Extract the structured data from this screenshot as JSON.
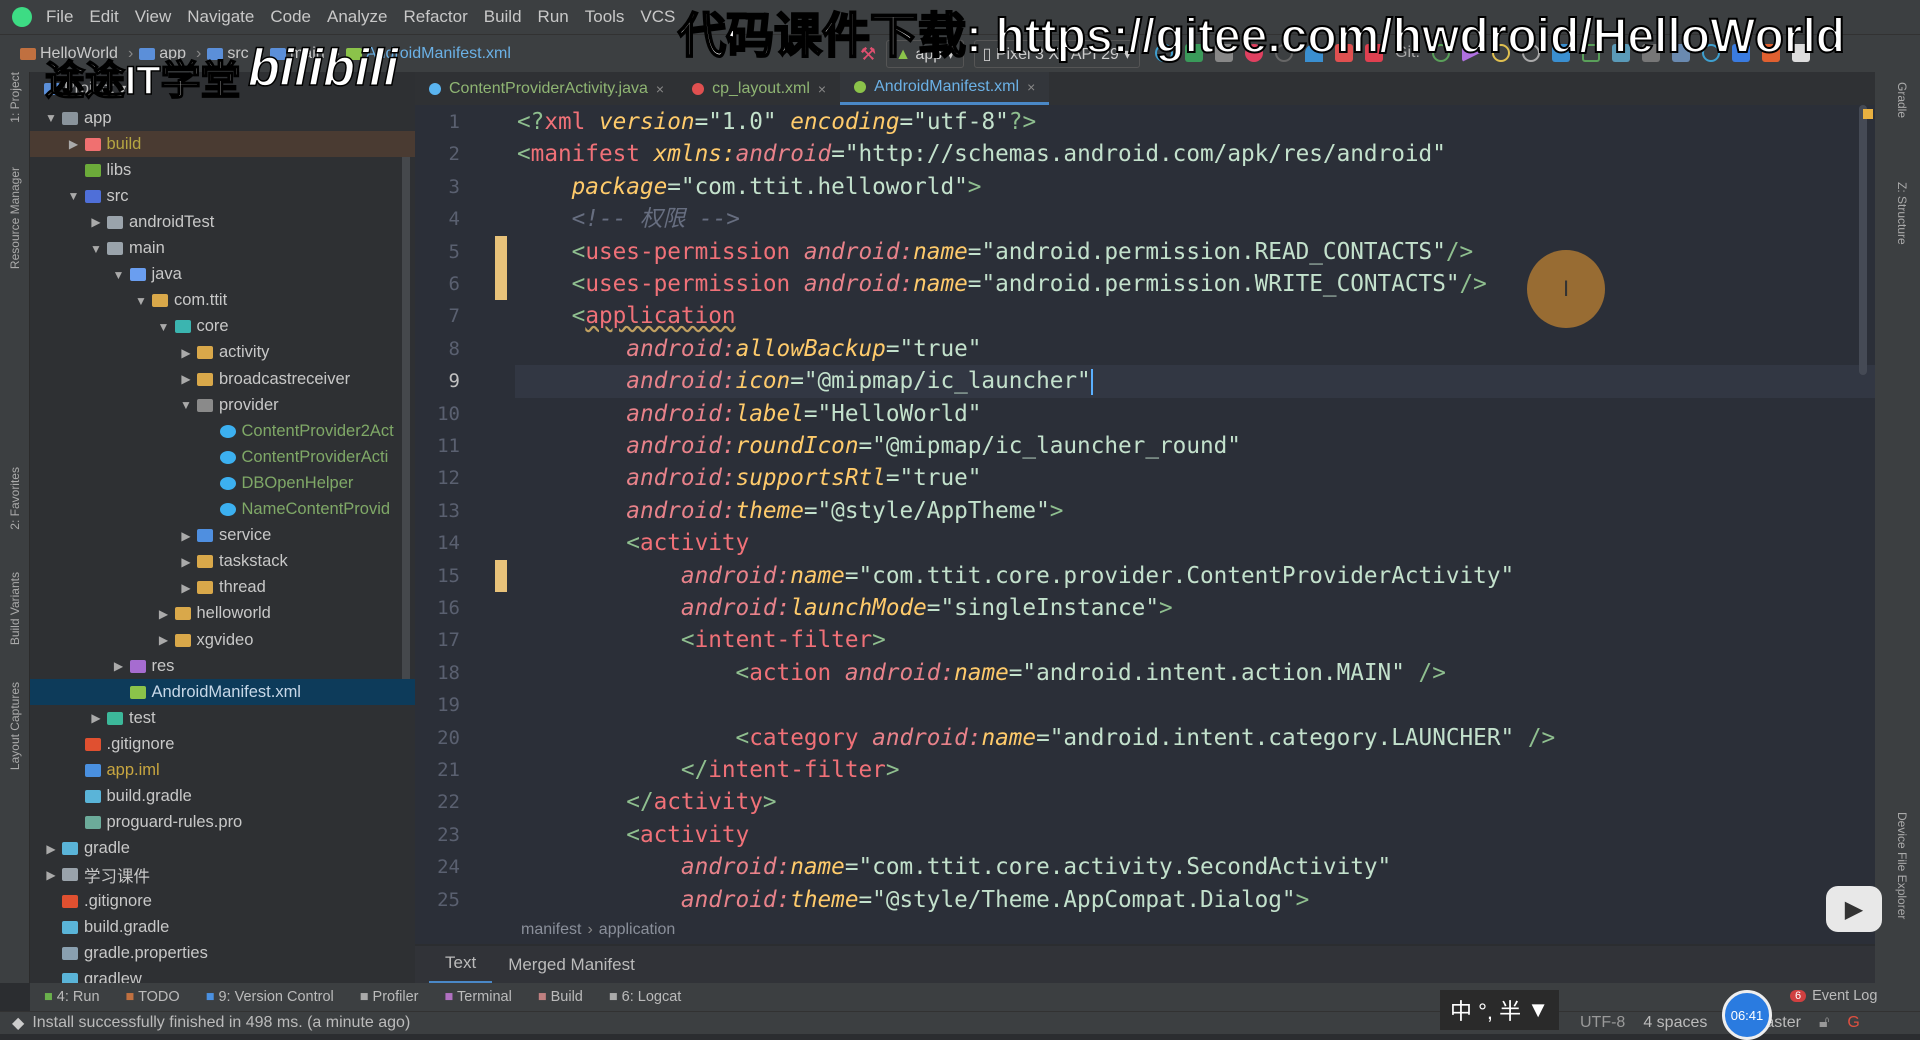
{
  "menu": [
    "File",
    "Edit",
    "View",
    "Navigate",
    "Code",
    "Analyze",
    "Refactor",
    "Build",
    "Run",
    "Tools",
    "VCS"
  ],
  "breadcrumb": [
    "HelloWorld",
    "app",
    "src",
    "main",
    "AndroidManifest.xml"
  ],
  "run_config": {
    "module": "app",
    "device": "Pixel 3 XL API 29",
    "git_label": "Git:"
  },
  "watermarks": {
    "channel": "途途IT学堂",
    "site_logo": "bilibili",
    "download": "代码课件下载: https://gitee.com/hwdroid/HelloWorld"
  },
  "project_panel": {
    "title": "Project"
  },
  "file_tabs": [
    {
      "label": "ContentProviderActivity.java",
      "color": "#8fb573",
      "icon": "#5ab4f0",
      "active": false
    },
    {
      "label": "cp_layout.xml",
      "color": "#8fb573",
      "icon": "#e05050",
      "active": false
    },
    {
      "label": "AndroidManifest.xml",
      "color": "#6bb1e6",
      "icon": "#8bc34a",
      "active": true
    }
  ],
  "tree": [
    {
      "level": 0,
      "arrow": "down",
      "icon": "#8a949c",
      "label": "app"
    },
    {
      "level": 1,
      "arrow": "right",
      "icon": "#f07070",
      "label": "build",
      "color": "#b5a642",
      "state": "highlight"
    },
    {
      "level": 1,
      "arrow": "",
      "icon": "#6cab3a",
      "label": "libs"
    },
    {
      "level": 1,
      "arrow": "down",
      "icon": "#4f6fd8",
      "label": "src"
    },
    {
      "level": 2,
      "arrow": "right",
      "icon": "#9aa3ab",
      "label": "androidTest"
    },
    {
      "level": 2,
      "arrow": "down",
      "icon": "#9aa3ab",
      "label": "main"
    },
    {
      "level": 3,
      "arrow": "down",
      "icon": "#6a9ef0",
      "label": "java"
    },
    {
      "level": 4,
      "arrow": "right-down",
      "icon": "#d9a84a",
      "label": "com.ttit"
    },
    {
      "level": 5,
      "arrow": "down",
      "icon": "#3bb5b0",
      "label": "core"
    },
    {
      "level": 6,
      "arrow": "right",
      "icon": "#d9a84a",
      "label": "activity"
    },
    {
      "level": 6,
      "arrow": "right",
      "icon": "#d9a84a",
      "label": "broadcastreceiver"
    },
    {
      "level": 6,
      "arrow": "down",
      "icon": "#8a8a8a",
      "label": "provider"
    },
    {
      "level": 7,
      "arrow": "",
      "icon": "#3cb0f0",
      "label": "ContentProvider2Act",
      "color": "#7fa867"
    },
    {
      "level": 7,
      "arrow": "",
      "icon": "#3cb0f0",
      "label": "ContentProviderActi",
      "color": "#7fa867"
    },
    {
      "level": 7,
      "arrow": "",
      "icon": "#3cb0f0",
      "label": "DBOpenHelper",
      "color": "#7fa867"
    },
    {
      "level": 7,
      "arrow": "",
      "icon": "#3cb0f0",
      "label": "NameContentProvid",
      "color": "#7fa867"
    },
    {
      "level": 6,
      "arrow": "right",
      "icon": "#4f8fe0",
      "label": "service"
    },
    {
      "level": 6,
      "arrow": "right",
      "icon": "#d9a84a",
      "label": "taskstack"
    },
    {
      "level": 6,
      "arrow": "right",
      "icon": "#d9a84a",
      "label": "thread"
    },
    {
      "level": 5,
      "arrow": "right",
      "icon": "#d9a84a",
      "label": "helloworld"
    },
    {
      "level": 5,
      "arrow": "right",
      "icon": "#d9a84a",
      "label": "xgvideo"
    },
    {
      "level": 3,
      "arrow": "right",
      "icon": "#a66cd0",
      "label": "res"
    },
    {
      "level": 3,
      "arrow": "",
      "icon": "#8bc34a",
      "label": "AndroidManifest.xml",
      "color": "#c8d8e8",
      "state": "selected"
    },
    {
      "level": 2,
      "arrow": "right",
      "icon": "#3cb89a",
      "label": "test"
    },
    {
      "level": 1,
      "arrow": "",
      "icon": "#e05030",
      "label": ".gitignore"
    },
    {
      "level": 1,
      "arrow": "",
      "icon": "#4a90e0",
      "label": "app.iml",
      "color": "#c8a640"
    },
    {
      "level": 1,
      "arrow": "",
      "icon": "#5ab4d8",
      "label": "build.gradle"
    },
    {
      "level": 1,
      "arrow": "",
      "icon": "#6cab9a",
      "label": "proguard-rules.pro"
    },
    {
      "level": 0,
      "arrow": "right",
      "icon": "#5ab4d8",
      "label": "gradle"
    },
    {
      "level": 0,
      "arrow": "right",
      "icon": "#9aa3ab",
      "label": "学习课件"
    },
    {
      "level": 0,
      "arrow": "",
      "icon": "#e05030",
      "label": ".gitignore"
    },
    {
      "level": 0,
      "arrow": "",
      "icon": "#5ab4d8",
      "label": "build.gradle"
    },
    {
      "level": 0,
      "arrow": "",
      "icon": "#8aa0b0",
      "label": "gradle.properties"
    },
    {
      "level": 0,
      "arrow": "",
      "icon": "#5ab4d8",
      "label": "gradlew"
    }
  ],
  "code": {
    "current_line": 9,
    "changed_lines": [
      5,
      6,
      15
    ],
    "lines": [
      [
        [
          "b",
          "<?"
        ],
        [
          "t",
          "xml"
        ],
        [
          "a",
          " version"
        ],
        [
          "v",
          "=\"1.0\" "
        ],
        [
          "a",
          "encoding"
        ],
        [
          "v",
          "=\"utf-8\""
        ],
        [
          "b",
          "?>"
        ]
      ],
      [
        [
          "b",
          "<"
        ],
        [
          "t",
          "manifest "
        ],
        [
          "a",
          "xmlns:"
        ],
        [
          "ns",
          "android"
        ],
        [
          "v",
          "=\"http://schemas.android.com/apk/res/android\""
        ]
      ],
      [
        [
          "v",
          "    "
        ],
        [
          "a",
          "package"
        ],
        [
          "v",
          "=\"com.ttit.helloworld\""
        ],
        [
          "b",
          ">"
        ]
      ],
      [
        [
          "c",
          "    <!-- 权限 -->"
        ]
      ],
      [
        [
          "v",
          "    "
        ],
        [
          "b",
          "<"
        ],
        [
          "t",
          "uses-permission "
        ],
        [
          "ns",
          "android:"
        ],
        [
          "a",
          "name"
        ],
        [
          "v",
          "=\"android.permission.READ_CONTACTS\""
        ],
        [
          "b",
          "/>"
        ]
      ],
      [
        [
          "v",
          "    "
        ],
        [
          "b",
          "<"
        ],
        [
          "t",
          "uses-permission "
        ],
        [
          "ns",
          "android:"
        ],
        [
          "a",
          "name"
        ],
        [
          "v",
          "=\"android.permission.WRITE_CONTACTS\""
        ],
        [
          "b",
          "/>"
        ]
      ],
      [
        [
          "v",
          "    "
        ],
        [
          "b",
          "<"
        ],
        [
          "tu",
          "application"
        ]
      ],
      [
        [
          "v",
          "        "
        ],
        [
          "ns",
          "android:"
        ],
        [
          "a",
          "allowBackup"
        ],
        [
          "v",
          "=\"true\""
        ]
      ],
      [
        [
          "v",
          "        "
        ],
        [
          "ns",
          "android:"
        ],
        [
          "a",
          "icon"
        ],
        [
          "v",
          "=\"@mipmap/ic_launcher\""
        ],
        [
          "caret",
          ""
        ]
      ],
      [
        [
          "v",
          "        "
        ],
        [
          "ns",
          "android:"
        ],
        [
          "a",
          "label"
        ],
        [
          "v",
          "=\"HelloWorld\""
        ]
      ],
      [
        [
          "v",
          "        "
        ],
        [
          "ns",
          "android:"
        ],
        [
          "a",
          "roundIcon"
        ],
        [
          "v",
          "=\"@mipmap/ic_launcher_round\""
        ]
      ],
      [
        [
          "v",
          "        "
        ],
        [
          "ns",
          "android:"
        ],
        [
          "a",
          "supportsRtl"
        ],
        [
          "v",
          "=\"true\""
        ]
      ],
      [
        [
          "v",
          "        "
        ],
        [
          "ns",
          "android:"
        ],
        [
          "a",
          "theme"
        ],
        [
          "v",
          "=\"@style/AppTheme\""
        ],
        [
          "b",
          ">"
        ]
      ],
      [
        [
          "v",
          "        "
        ],
        [
          "b",
          "<"
        ],
        [
          "t",
          "activity"
        ]
      ],
      [
        [
          "v",
          "            "
        ],
        [
          "ns",
          "android:"
        ],
        [
          "a",
          "name"
        ],
        [
          "v",
          "=\"com.ttit.core.provider.ContentProviderActivity\""
        ]
      ],
      [
        [
          "v",
          "            "
        ],
        [
          "ns",
          "android:"
        ],
        [
          "a",
          "launchMode"
        ],
        [
          "v",
          "=\"singleInstance\""
        ],
        [
          "b",
          ">"
        ]
      ],
      [
        [
          "v",
          "            "
        ],
        [
          "b",
          "<"
        ],
        [
          "t",
          "intent-filter"
        ],
        [
          "b",
          ">"
        ]
      ],
      [
        [
          "v",
          "                "
        ],
        [
          "b",
          "<"
        ],
        [
          "t",
          "action "
        ],
        [
          "ns",
          "android:"
        ],
        [
          "a",
          "name"
        ],
        [
          "v",
          "=\"android.intent.action.MAIN\" "
        ],
        [
          "b",
          "/>"
        ]
      ],
      [],
      [
        [
          "v",
          "                "
        ],
        [
          "b",
          "<"
        ],
        [
          "t",
          "category "
        ],
        [
          "ns",
          "android:"
        ],
        [
          "a",
          "name"
        ],
        [
          "v",
          "=\"android.intent.category.LAUNCHER\" "
        ],
        [
          "b",
          "/>"
        ]
      ],
      [
        [
          "v",
          "            "
        ],
        [
          "b",
          "</"
        ],
        [
          "t",
          "intent-filter"
        ],
        [
          "b",
          ">"
        ]
      ],
      [
        [
          "v",
          "        "
        ],
        [
          "b",
          "</"
        ],
        [
          "t",
          "activity"
        ],
        [
          "b",
          ">"
        ]
      ],
      [
        [
          "v",
          "        "
        ],
        [
          "b",
          "<"
        ],
        [
          "t",
          "activity"
        ]
      ],
      [
        [
          "v",
          "            "
        ],
        [
          "ns",
          "android:"
        ],
        [
          "a",
          "name"
        ],
        [
          "v",
          "=\"com.ttit.core.activity.SecondActivity\""
        ]
      ],
      [
        [
          "v",
          "            "
        ],
        [
          "ns",
          "android:"
        ],
        [
          "a",
          "theme"
        ],
        [
          "v",
          "=\"@style/Theme.AppCompat.Dialog\""
        ],
        [
          "b",
          ">"
        ]
      ]
    ]
  },
  "editor_breadcrumb": [
    "manifest",
    "application"
  ],
  "editor_tabs": [
    {
      "label": "Text",
      "active": true
    },
    {
      "label": "Merged Manifest",
      "active": false
    }
  ],
  "tool_windows": [
    "4: Run",
    "TODO",
    "9: Version Control",
    "Profiler",
    "Terminal",
    "Build",
    "6: Logcat"
  ],
  "left_stripe": [
    "1: Project",
    "Resource Manager",
    "2: Favorites",
    "Build Variants",
    "Layout Captures"
  ],
  "right_stripe": [
    "Gradle",
    "Z: Structure",
    "Device File Explorer"
  ],
  "status": {
    "message": "Install successfully finished in 498 ms. (a minute ago)",
    "ime": "中 °, 半",
    "encoding": "UTF-8",
    "indent": "4 spaces",
    "branch": "aster",
    "clock": "06:41",
    "event_log": "Event Log",
    "event_count": "6"
  }
}
